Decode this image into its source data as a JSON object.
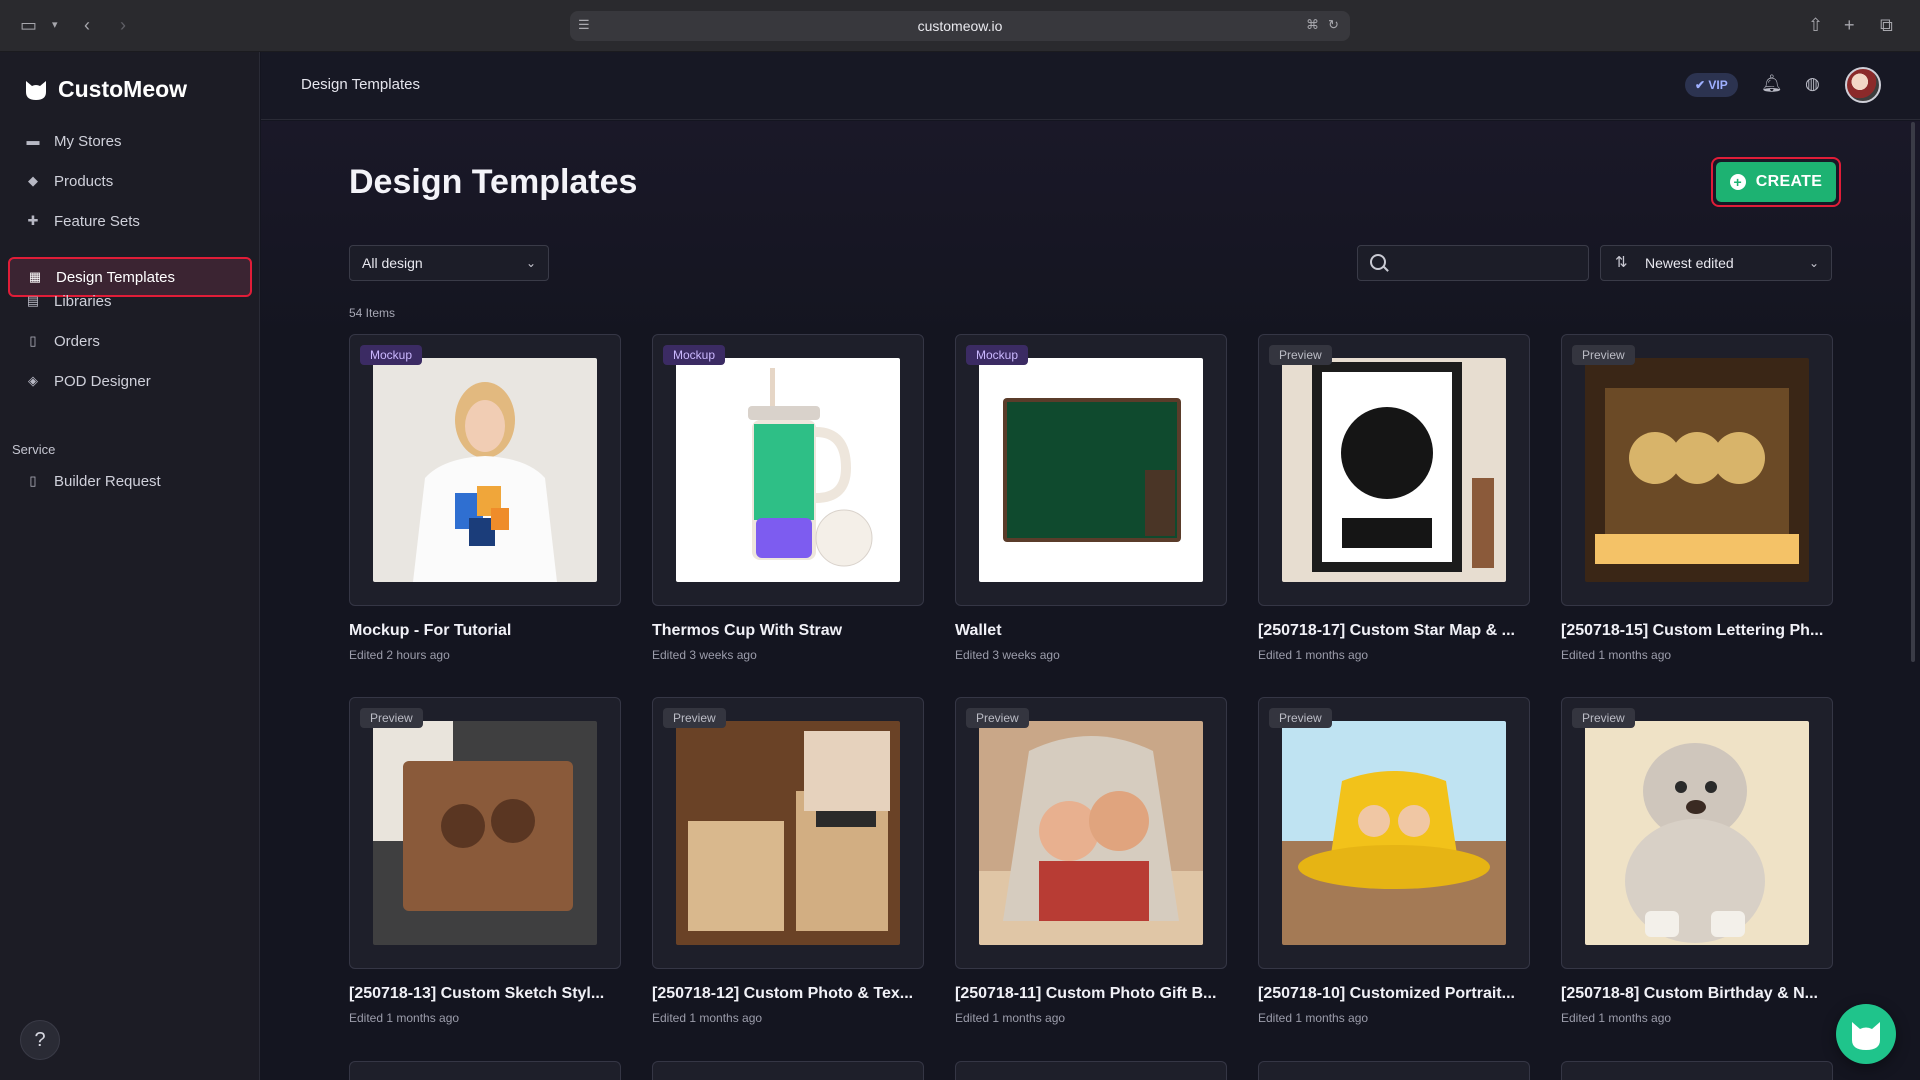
{
  "browser": {
    "url": "customeow.io"
  },
  "brand": {
    "name": "CustoMeow"
  },
  "sidebar": {
    "items": [
      {
        "label": "My Stores",
        "icon": "store-icon"
      },
      {
        "label": "Products",
        "icon": "tag-icon"
      },
      {
        "label": "Feature Sets",
        "icon": "puzzle-icon"
      },
      {
        "label": "Design Templates",
        "icon": "grid-icon",
        "active": true
      },
      {
        "label": "Libraries",
        "icon": "library-icon"
      },
      {
        "label": "Orders",
        "icon": "document-icon"
      },
      {
        "label": "POD Designer",
        "icon": "palette-icon"
      }
    ],
    "service_label": "Service",
    "service_items": [
      {
        "label": "Builder Request",
        "icon": "document-icon"
      }
    ],
    "help_label": "?"
  },
  "header": {
    "breadcrumb": "Design Templates",
    "vip_label": "VIP"
  },
  "main": {
    "title": "Design Templates",
    "create_label": "CREATE",
    "filter_value": "All design",
    "search_placeholder": "",
    "sort_value": "Newest edited",
    "items_count": "54 Items",
    "cards": [
      {
        "badge": "Mockup",
        "title": "Mockup - For Tutorial",
        "edited": "Edited 2 hours ago"
      },
      {
        "badge": "Mockup",
        "title": "Thermos Cup With Straw",
        "edited": "Edited 3 weeks ago"
      },
      {
        "badge": "Mockup",
        "title": "Wallet",
        "edited": "Edited 3 weeks ago"
      },
      {
        "badge": "Preview",
        "title": "[250718-17] Custom Star Map & ...",
        "edited": "Edited 1 months ago"
      },
      {
        "badge": "Preview",
        "title": "[250718-15] Custom Lettering Ph...",
        "edited": "Edited 1 months ago"
      },
      {
        "badge": "Preview",
        "title": "[250718-13] Custom Sketch Styl...",
        "edited": "Edited 1 months ago"
      },
      {
        "badge": "Preview",
        "title": "[250718-12] Custom Photo & Tex...",
        "edited": "Edited 1 months ago"
      },
      {
        "badge": "Preview",
        "title": "[250718-11] Custom Photo Gift B...",
        "edited": "Edited 1 months ago"
      },
      {
        "badge": "Preview",
        "title": "[250718-10] Customized Portrait...",
        "edited": "Edited 1 months ago"
      },
      {
        "badge": "Preview",
        "title": "[250718-8] Custom Birthday & N...",
        "edited": "Edited 1 months ago"
      }
    ]
  },
  "colors": {
    "accent_green": "#1db272",
    "highlight_red": "#e01d38",
    "mockup_badge": "#3b2b63",
    "preview_badge": "#34353f"
  }
}
